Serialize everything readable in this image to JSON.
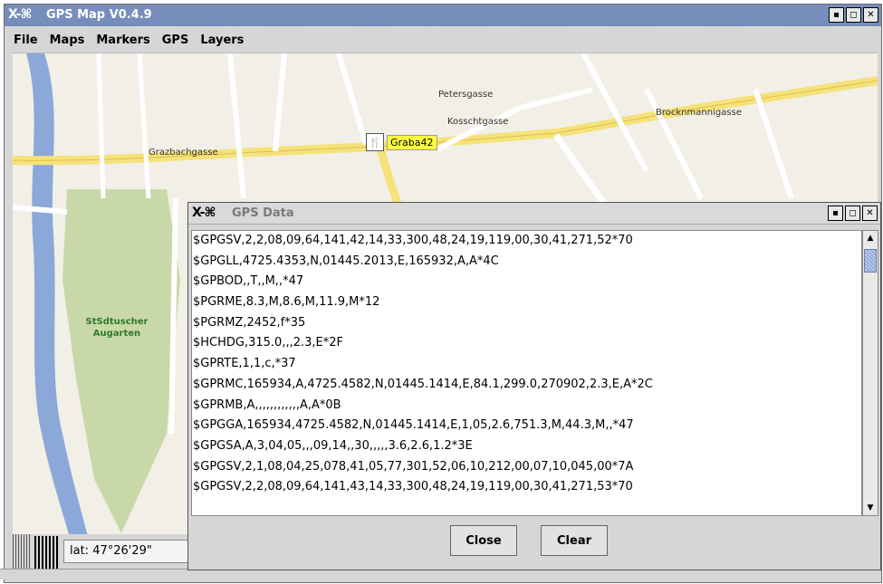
{
  "main_window": {
    "title": "GPS Map V0.4.9",
    "logo_glyph": "X-⌘",
    "controls": [
      "▪",
      "◻",
      "✕"
    ]
  },
  "menu": [
    {
      "label": "File",
      "mnemonic": "F"
    },
    {
      "label": "Maps",
      "mnemonic": "M"
    },
    {
      "label": "Markers",
      "mnemonic": "a"
    },
    {
      "label": "GPS",
      "mnemonic": "G"
    },
    {
      "label": "Layers",
      "mnemonic": "L"
    }
  ],
  "map": {
    "poi_label": "Graba42",
    "poi_icon": "restaurant-icon",
    "park_label_1": "StSdtuscher",
    "park_label_2": "Augarten",
    "street_labels": [
      "Grazbachgasse",
      "Kosschtgasse",
      "Brocknmannigasse",
      "Petersgasse"
    ]
  },
  "status": {
    "lat": "lat: 47°26'29\""
  },
  "dialog": {
    "title": "GPS Data",
    "logo_glyph": "X-⌘",
    "controls": [
      "▪",
      "◻",
      "✕"
    ],
    "lines": [
      "$GPGSV,2,2,08,09,64,141,42,14,33,300,48,24,19,119,00,30,41,271,52*70",
      "$GPGLL,4725.4353,N,01445.2013,E,165932,A,A*4C",
      "$GPBOD,,T,,M,,*47",
      "$PGRME,8.3,M,8.6,M,11.9,M*12",
      "$PGRMZ,2452,f*35",
      "$HCHDG,315.0,,,2.3,E*2F",
      "$GPRTE,1,1,c,*37",
      "$GPRMC,165934,A,4725.4582,N,01445.1414,E,84.1,299.0,270902,2.3,E,A*2C",
      "$GPRMB,A,,,,,,,,,,,,A,A*0B",
      "$GPGGA,165934,4725.4582,N,01445.1414,E,1,05,2.6,751.3,M,44.3,M,,*47",
      "$GPGSA,A,3,04,05,,,09,14,,30,,,,,3.6,2.6,1.2*3E",
      "$GPGSV,2,1,08,04,25,078,41,05,77,301,52,06,10,212,00,07,10,045,00*7A",
      "$GPGSV,2,2,08,09,64,141,43,14,33,300,48,24,19,119,00,30,41,271,53*70"
    ],
    "close_label": "Close",
    "clear_label": "Clear"
  }
}
